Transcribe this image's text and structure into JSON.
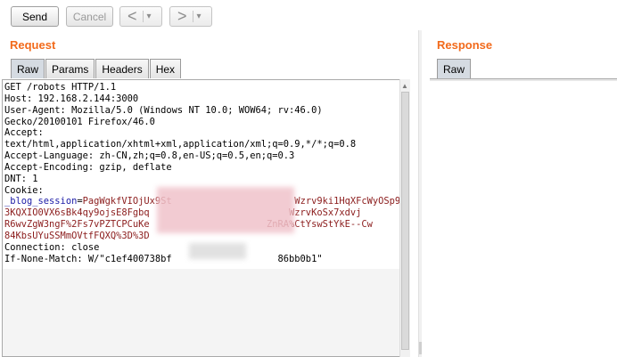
{
  "toolbar": {
    "send_label": "Send",
    "cancel_label": "Cancel",
    "back_glyph": "<",
    "forward_glyph": ">",
    "dropdown_glyph": "▾"
  },
  "request": {
    "title": "Request",
    "tabs": [
      "Raw",
      "Params",
      "Headers",
      "Hex"
    ],
    "active_tab": "Raw",
    "lines": {
      "l1": "GET /robots HTTP/1.1",
      "l2": "Host: 192.168.2.144:3000",
      "l3": "User-Agent: Mozilla/5.0 (Windows NT 10.0; WOW64; rv:46.0)",
      "l4": "Gecko/20100101 Firefox/46.0",
      "l5": "Accept:",
      "l6": "text/html,application/xhtml+xml,application/xml;q=0.9,*/*;q=0.8",
      "l7": "Accept-Language: zh-CN,zh;q=0.8,en-US;q=0.5,en;q=0.3",
      "l8": "Accept-Encoding: gzip, deflate",
      "l9": "DNT: 1",
      "l10": "Cookie:",
      "cookie_name": "_blog_session",
      "cookie_eq": "=",
      "cookie_v1": "PagWgkfVIOjUx9St                      Wzrv9ki1HqXFcWyOSp9Ln",
      "cookie_v2": "3KQXIO0VX6sBk4qy9ojsE8Fgbq                         WzrvKoSx7xdvj",
      "cookie_v3": "R6wvZgW3ngF%2Fs7vPZTCPCuKe                     ZnRA%CtYswStYkE--Cw",
      "cookie_v4": "84KbsUYuSSMmOVtfFQXQ%3D%3D",
      "l15": "Connection: close",
      "l16": "If-None-Match: W/\"c1ef400738bf                   86bb0b1\""
    }
  },
  "response": {
    "title": "Response",
    "tabs": [
      "Raw"
    ],
    "active_tab": "Raw"
  },
  "colors": {
    "accent": "#f26a1b",
    "header_key": "#1a1aa6",
    "header_value": "#8b1c1c"
  }
}
